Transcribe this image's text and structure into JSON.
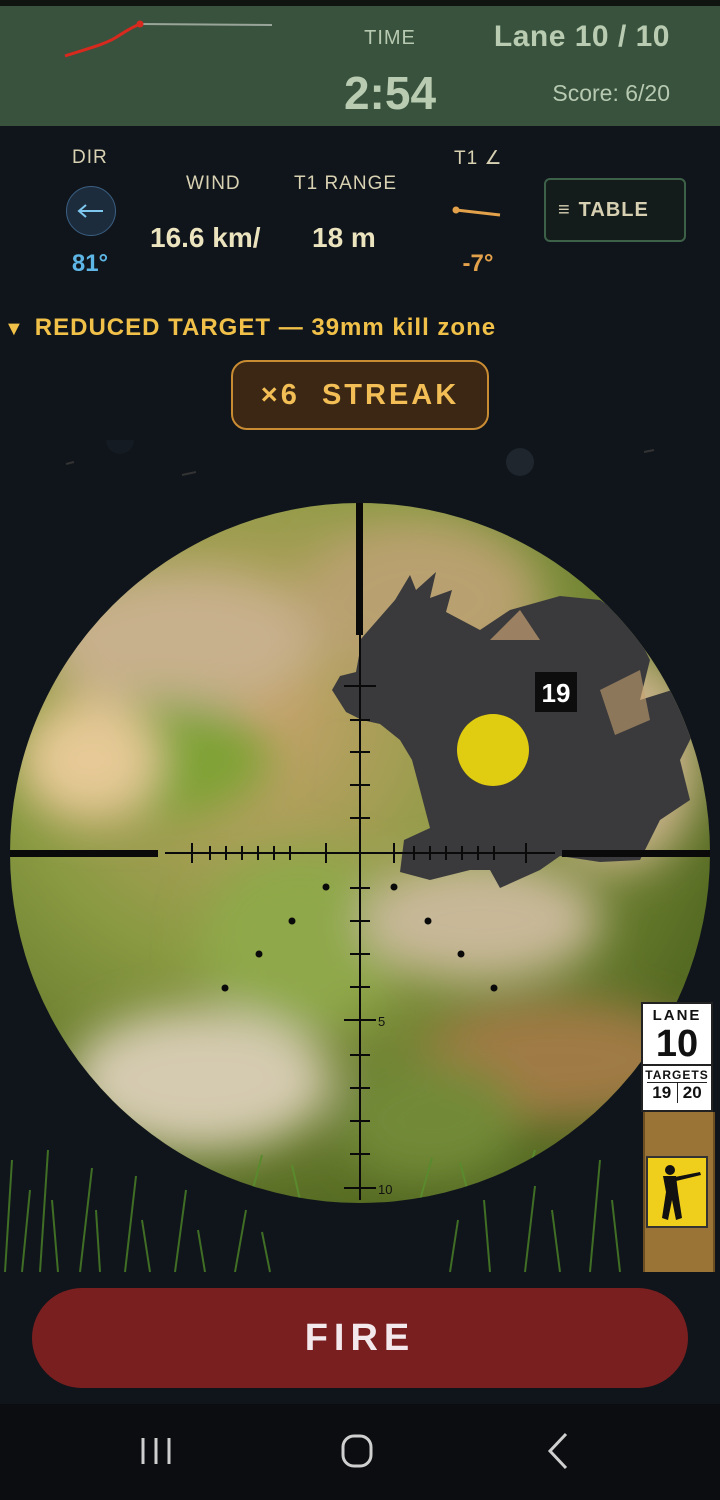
{
  "header": {
    "time_label": "TIME",
    "time_value": "2:54",
    "lane_label": "Lane 10 / 10",
    "score_label": "Score: 6/20",
    "trend_color": "#d8291f"
  },
  "hud": {
    "dir_label": "DIR",
    "dir_value": "81°",
    "dir_icon": "arrow-left-icon",
    "wind_label": "WIND",
    "wind_value": "16.6 km/",
    "range_label": "T1 RANGE",
    "range_value": "18 m",
    "angle_label": "T1 ∠",
    "angle_value": "-7°",
    "table_glyph": "≡",
    "table_label": "TABLE"
  },
  "warning": {
    "glyph": "▼",
    "text": "REDUCED TARGET — 39mm kill zone"
  },
  "streak": {
    "text": "×6  STREAK"
  },
  "scope": {
    "target_number": "19",
    "reticle_mark_5": "5",
    "reticle_mark_10": "10",
    "kill_zone_color": "#e0cc10"
  },
  "lane_card": {
    "lane_label": "LANE",
    "lane_number": "10",
    "targets_label": "TARGETS",
    "target_a": "19",
    "target_b": "20",
    "sign_icon": "shooter-icon"
  },
  "fire": {
    "label": "FIRE",
    "color": "#7a1f1f"
  },
  "nav": {
    "recents_icon": "recent-apps-icon",
    "home_icon": "home-icon",
    "back_icon": "back-icon"
  }
}
